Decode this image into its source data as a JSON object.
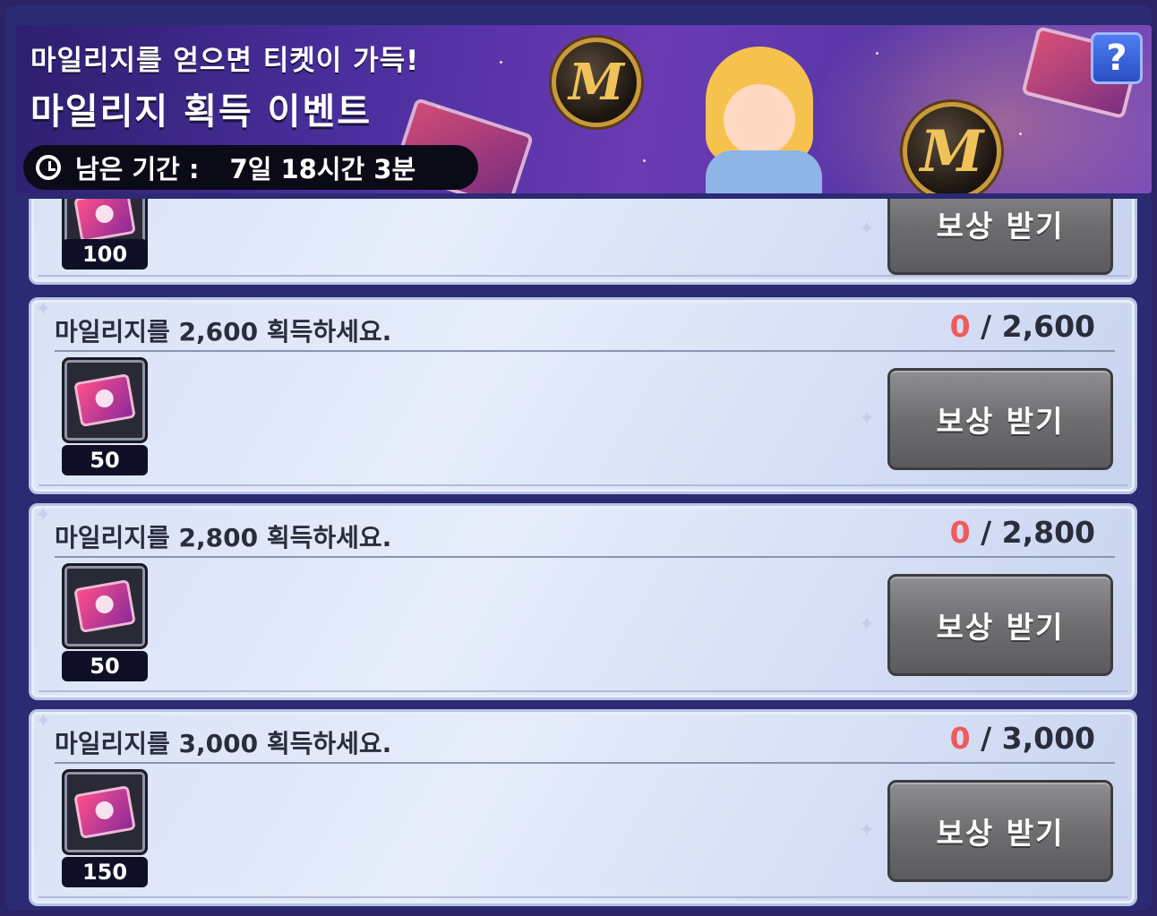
{
  "banner": {
    "subtitle": "마일리지를 얻으면 티켓이 가득!",
    "title": "마일리지 획득 이벤트",
    "timer_label": "남은 기간 :",
    "timer_value": "7일 18시간 3분",
    "help_label": "?",
    "coin_letter": "M"
  },
  "missions": [
    {
      "title": "",
      "progress_current": "",
      "progress_sep": "",
      "progress_target": "",
      "reward_count": "100",
      "claim_label": "보상 받기"
    },
    {
      "title": "마일리지를 2,600 획득하세요.",
      "progress_current": "0",
      "progress_sep": " / ",
      "progress_target": "2,600",
      "reward_count": "50",
      "claim_label": "보상 받기"
    },
    {
      "title": "마일리지를 2,800 획득하세요.",
      "progress_current": "0",
      "progress_sep": " / ",
      "progress_target": "2,800",
      "reward_count": "50",
      "claim_label": "보상 받기"
    },
    {
      "title": "마일리지를 3,000 획득하세요.",
      "progress_current": "0",
      "progress_sep": " / ",
      "progress_target": "3,000",
      "reward_count": "150",
      "claim_label": "보상 받기"
    }
  ],
  "colors": {
    "progress_current": "#f05a5a",
    "panel_bg": "#2b2a72",
    "claim_button": "#6e6e71"
  },
  "icons": {
    "timer": "clock-icon",
    "reward": "ticket-icon",
    "help": "question-icon"
  }
}
